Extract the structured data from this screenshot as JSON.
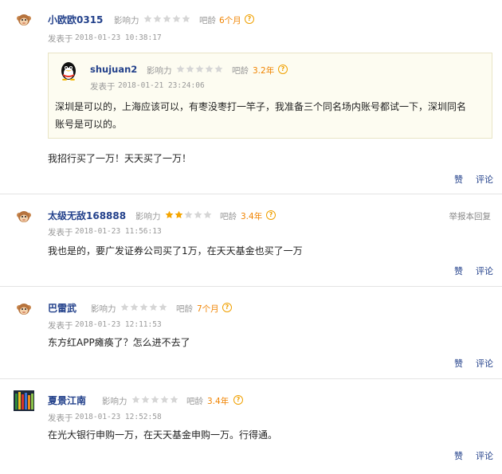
{
  "labels": {
    "influence": "影响力",
    "bar_age": "吧龄",
    "posted_at": "发表于",
    "like": "赞",
    "comment": "评论",
    "report": "举报本回复"
  },
  "posts": [
    {
      "username": "小欧欧0315",
      "influence_stars": 0,
      "bar_age": "6个月",
      "time": "2018-01-23 10:38:17",
      "content": "我招行买了一万！天天买了一万！",
      "quote": {
        "username": "shujuan2",
        "influence_stars": 0,
        "bar_age": "3.2年",
        "time": "2018-01-21 23:24:06",
        "line1": "深圳是可以的，上海应该可以，有枣没枣打一竿子，我准备三个同名场内账号都试一下，深圳同名",
        "line2": "账号是可以的。"
      }
    },
    {
      "username": "太级无敌168888",
      "influence_stars": 2,
      "bar_age": "3.4年",
      "time": "2018-01-23 11:56:13",
      "content": "我也是的，要广发证券公司买了1万，在天天基金也买了一万"
    },
    {
      "username": "巴雷武",
      "influence_stars": 0,
      "bar_age": "7个月",
      "time": "2018-01-23 12:11:53",
      "content": "东方红APP瘫痪了？怎么进不去了"
    },
    {
      "username": "夏景江南",
      "influence_stars": 0,
      "bar_age": "3.4年",
      "time": "2018-01-23 12:52:58",
      "content": "在光大银行申购一万，在天天基金申购一万。行得通。"
    }
  ],
  "colors": {
    "username": "#23418b",
    "age": "#f08300",
    "star_on": "#f5a500",
    "star_off": "#d6d6d6"
  }
}
